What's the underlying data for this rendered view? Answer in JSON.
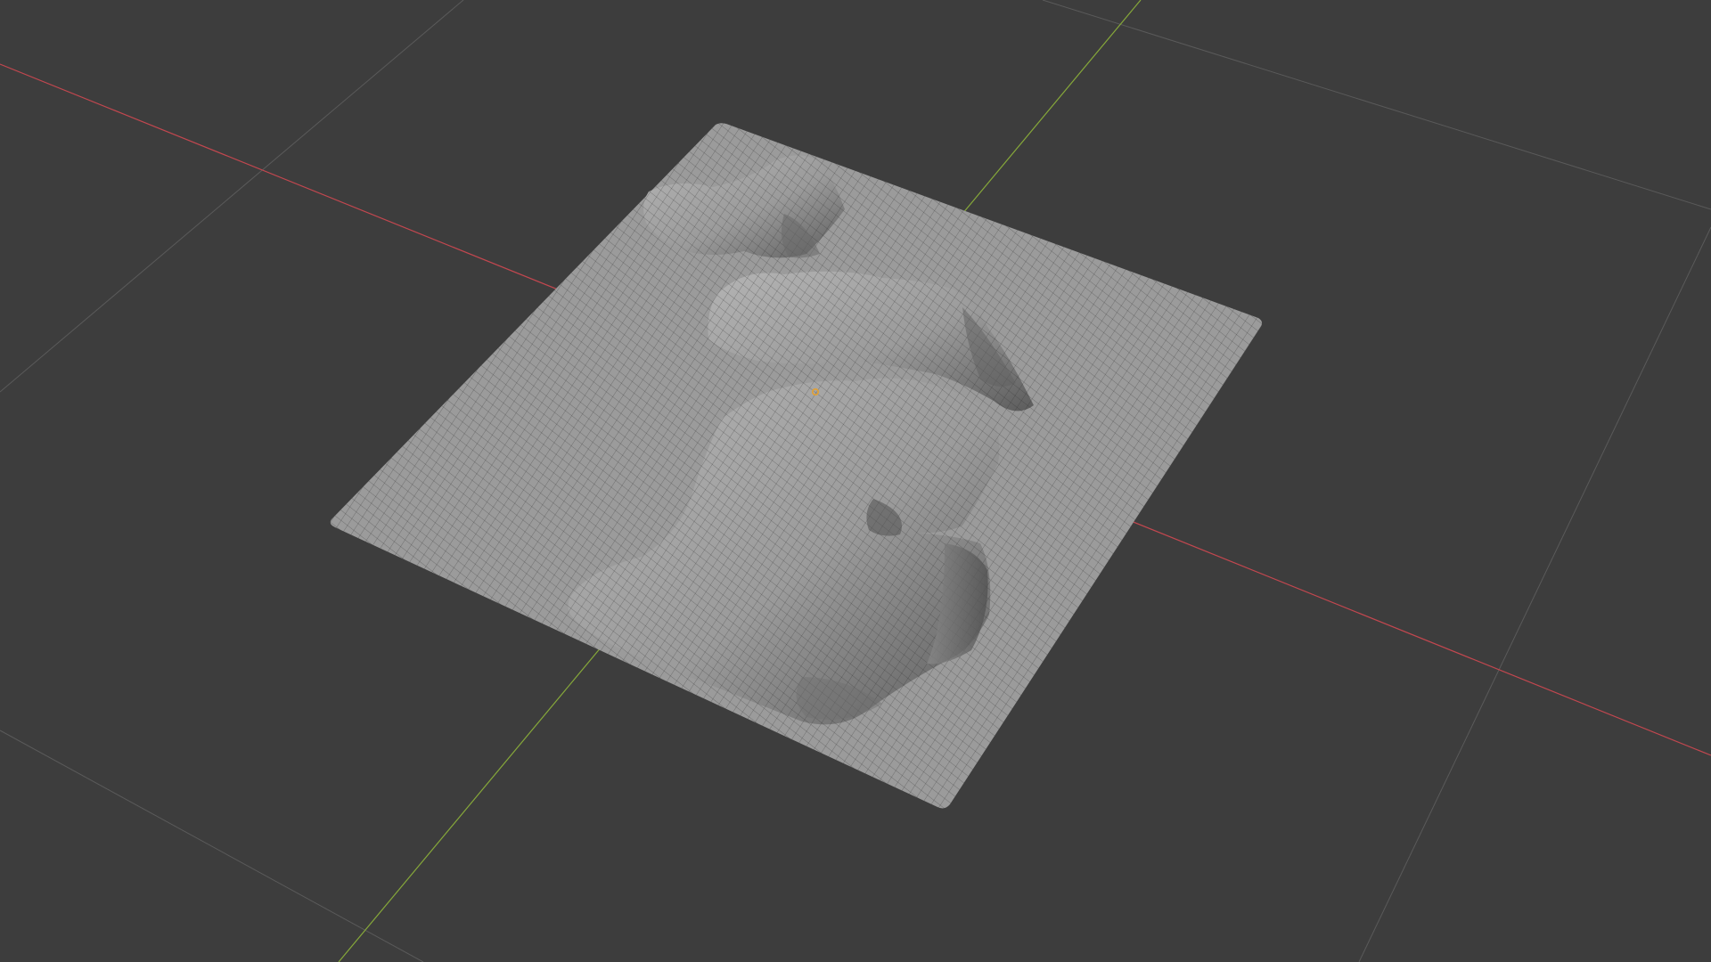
{
  "viewport": {
    "background": "#3d3d3d",
    "grid_color": "#5a5a5a",
    "x_axis_color": "#c2474f",
    "y_axis_color": "#86a83a"
  },
  "mesh": {
    "fill": "#9b9b9b",
    "highlight": "#b4b4b4",
    "shadow": "#5c5c5c",
    "wire": "#2b2b2b"
  },
  "origin_marker": {
    "color": "#e4a030"
  },
  "icons": {
    "origin": "object-origin-icon"
  }
}
